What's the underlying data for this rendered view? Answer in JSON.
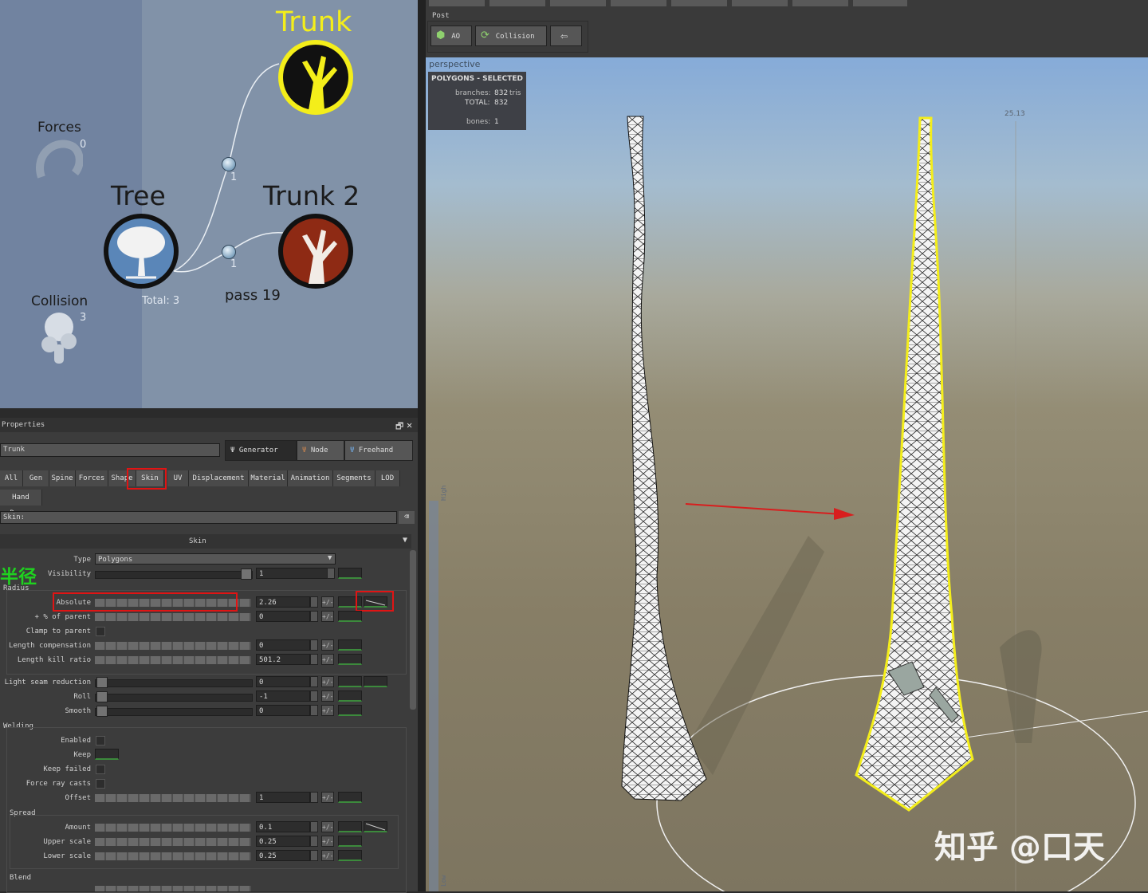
{
  "graph": {
    "nodes": {
      "trunk": {
        "label": "Trunk"
      },
      "tree": {
        "label": "Tree",
        "total": "Total: 3"
      },
      "trunk2": {
        "label": "Trunk 2"
      },
      "forces": {
        "label": "Forces",
        "count": "0"
      },
      "collision": {
        "label": "Collision",
        "count": "3"
      }
    },
    "ports": {
      "p1": "1",
      "p2": "1"
    },
    "pass_text": "pass 19"
  },
  "properties": {
    "title": "Properties",
    "name_value": "Trunk",
    "modes": [
      "Generator",
      "Node",
      "Freehand"
    ],
    "tabs": [
      "All",
      "Gen",
      "Spine",
      "Forces",
      "Shape",
      "Skin",
      "UV",
      "Displacement",
      "Material",
      "Animation",
      "Segments",
      "LOD"
    ],
    "tab_row2": "Hand Drawn",
    "filter_label": "Skin:",
    "section_title": "Skin",
    "annotation": "半径",
    "type": {
      "label": "Type",
      "value": "Polygons"
    },
    "visibility": {
      "label": "Visibility",
      "value": "1"
    },
    "radius_group": "Radius",
    "absolute": {
      "label": "Absolute",
      "value": "2.26"
    },
    "pct_parent": {
      "label": "+ % of parent",
      "value": "0"
    },
    "clamp": {
      "label": "Clamp to parent"
    },
    "length_comp": {
      "label": "Length compensation",
      "value": "0"
    },
    "length_kill": {
      "label": "Length kill ratio",
      "value": "501.2"
    },
    "light_seam": {
      "label": "Light seam reduction",
      "value": "0"
    },
    "roll": {
      "label": "Roll",
      "value": "-1"
    },
    "smooth": {
      "label": "Smooth",
      "value": "0"
    },
    "welding_group": "Welding",
    "enabled": {
      "label": "Enabled"
    },
    "keep": {
      "label": "Keep"
    },
    "keep_failed": {
      "label": "Keep failed"
    },
    "force_ray": {
      "label": "Force ray casts"
    },
    "offset": {
      "label": "Offset",
      "value": "1"
    },
    "spread_group": "Spread",
    "amount": {
      "label": "Amount",
      "value": "0.1"
    },
    "upper_scale": {
      "label": "Upper scale",
      "value": "0.25"
    },
    "lower_scale": {
      "label": "Lower scale",
      "value": "0.25"
    },
    "blend_group": "Blend",
    "pm": "+/-"
  },
  "toolbar": {
    "section": "Post",
    "buttons": [
      "AO",
      "Collision"
    ]
  },
  "viewport": {
    "label": "perspective",
    "stats": {
      "heading": "POLYGONS - SELECTED",
      "branches_label": "branches:",
      "branches_value": "832",
      "branches_unit": "tris",
      "total_label": "TOTAL:",
      "total_value": "832",
      "bones_label": "bones:",
      "bones_value": "1"
    },
    "height_label": "25.13",
    "ruler_high": "High",
    "ruler_low": "Low"
  },
  "watermark": "知乎 @口天",
  "colors": {
    "accent_selected": "#f4ee1a",
    "highlight_red": "#e01414",
    "annotation_green": "#1fd21f"
  }
}
